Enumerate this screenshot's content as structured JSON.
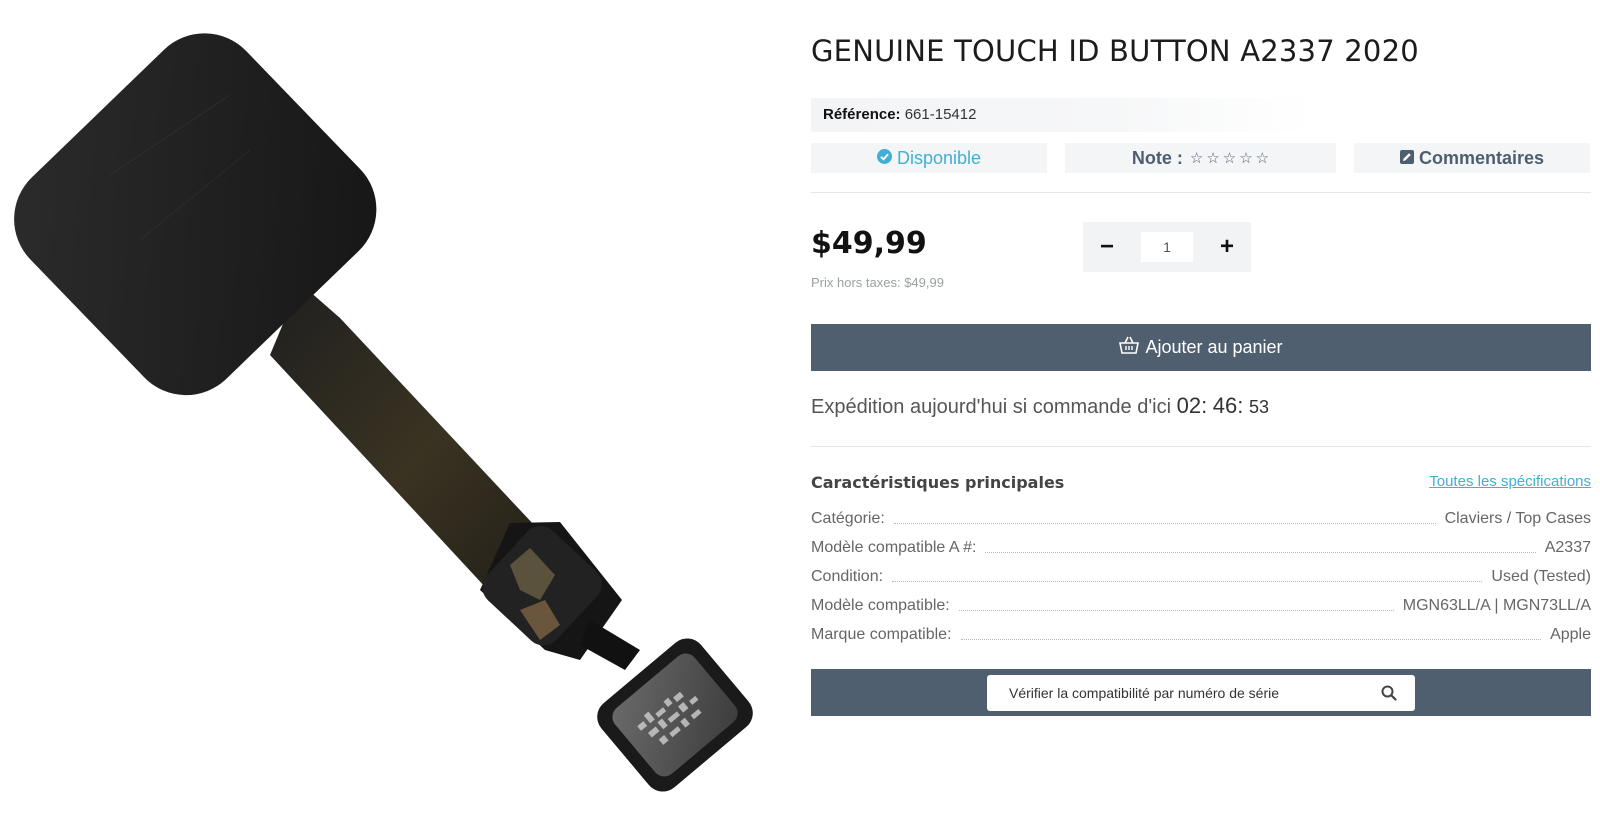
{
  "product": {
    "title": "GENUINE TOUCH ID BUTTON A2337 2020",
    "reference_label": "Référence:",
    "reference_value": "661-15412",
    "availability": "Disponible",
    "rating_label": "Note :",
    "rating_value": 0,
    "rating_max": 5,
    "comments_label": "Commentaires",
    "price": "$49,99",
    "price_note": "Prix hors taxes: $49,99",
    "quantity": "1",
    "decrement_label": "−",
    "increment_label": "+",
    "add_to_cart_label": "Ajouter au panier",
    "accent_color": "#42b0d5",
    "button_color": "#4f5f6f"
  },
  "shipping": {
    "text": "Expédition aujourd'hui si commande d'ici",
    "hours": "02",
    "minutes": "46",
    "seconds": "53",
    "sep1": ":",
    "sep2": ":"
  },
  "features": {
    "title": "Caractéristiques principales",
    "all_specs_link": "Toutes les spécifications",
    "rows": [
      {
        "label": "Catégorie:",
        "value": "Claviers / Top Cases"
      },
      {
        "label": "Modèle compatible A #:",
        "value": "A2337"
      },
      {
        "label": "Condition:",
        "value": "Used (Tested)"
      },
      {
        "label": "Modèle compatible:",
        "value": "MGN63LL/A | MGN73LL/A"
      },
      {
        "label": "Marque compatible:",
        "value": "Apple"
      }
    ]
  },
  "compat": {
    "placeholder": "Vérifier la compatibilité par numéro de série"
  },
  "icons": {
    "availability": "check-circle-icon",
    "rating": "star-outline-icon",
    "comments": "edit-icon",
    "cart": "basket-icon",
    "search": "search-icon"
  }
}
